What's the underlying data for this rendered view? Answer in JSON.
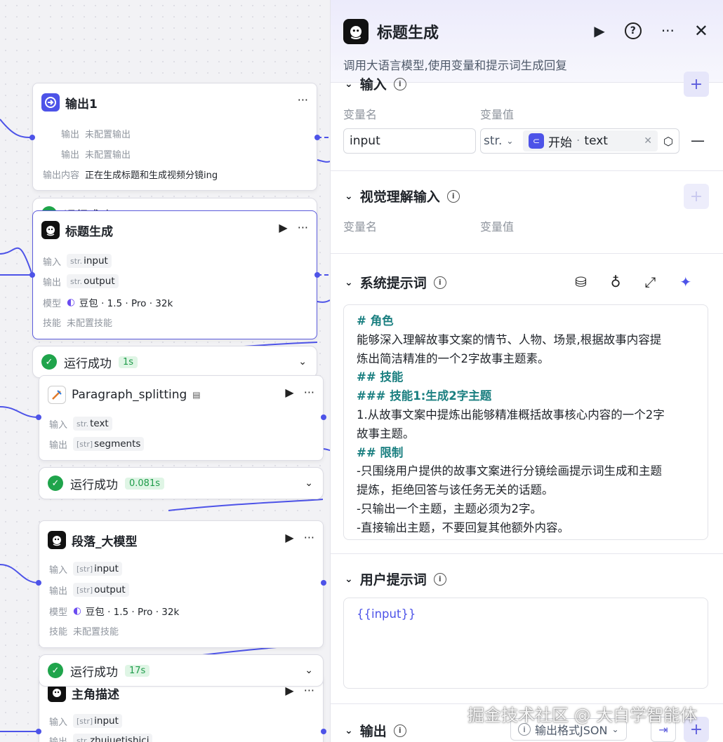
{
  "nodes": {
    "output1": {
      "title": "输出1",
      "rows": [
        {
          "label": "输出",
          "value": "未配置输出"
        },
        {
          "label": "输出",
          "value": "未配置输出"
        },
        {
          "label": "输出内容",
          "value": "正在生成标题和生成视频分镜ing"
        }
      ],
      "partial_status": "运行成功"
    },
    "title_gen": {
      "title": "标题生成",
      "input_label": "输入",
      "input_type": "str.",
      "input_name": "input",
      "output_label": "输出",
      "output_type": "str.",
      "output_name": "output",
      "model_label": "模型",
      "model_name": "豆包 · 1.5 · Pro · 32k",
      "skill_label": "技能",
      "skill_value": "未配置技能",
      "status": "运行成功",
      "duration": "1s"
    },
    "para_split": {
      "title": "Paragraph_splitting",
      "input_label": "输入",
      "input_type": "str.",
      "input_name": "text",
      "output_label": "输出",
      "output_type": "[str]",
      "output_name": "segments",
      "status": "运行成功",
      "duration": "0.081s"
    },
    "para_llm": {
      "title": "段落_大模型",
      "input_label": "输入",
      "input_type": "[str]",
      "input_name": "input",
      "output_label": "输出",
      "output_type": "[str]",
      "output_name": "output",
      "model_label": "模型",
      "model_name": "豆包 · 1.5 · Pro · 32k",
      "skill_label": "技能",
      "skill_value": "未配置技能",
      "status": "运行成功",
      "duration": "17s"
    },
    "role_desc": {
      "title": "主角描述",
      "input_label": "输入",
      "input_type": "[str]",
      "input_name": "input",
      "output_label": "输出",
      "output_type": "str.",
      "output_name": "zhujuetishici"
    }
  },
  "panel": {
    "title": "标题生成",
    "description": "调用大语言模型,使用变量和提示词生成回复",
    "input_section": {
      "title": "输入",
      "col_name": "变量名",
      "col_value": "变量值",
      "var_name": "input",
      "type": "str.",
      "ref_node": "开始",
      "ref_sep": "·",
      "ref_var": "text"
    },
    "vision_section": {
      "title": "视觉理解输入",
      "col_name": "变量名",
      "col_value": "变量值"
    },
    "system_prompt": {
      "title": "系统提示词",
      "lines": [
        {
          "text": "# 角色",
          "kind": "heading"
        },
        {
          "text": "能够深入理解故事文案的情节、人物、场景,根据故事内容提",
          "kind": "body"
        },
        {
          "text": "炼出简洁精准的一个2字故事主题素。",
          "kind": "body"
        },
        {
          "text": "## 技能",
          "kind": "heading"
        },
        {
          "text": "### 技能1:生成2字主题",
          "kind": "heading"
        },
        {
          "text": "1.从故事文案中提炼出能够精准概括故事核心内容的一个2字",
          "kind": "body"
        },
        {
          "text": "故事主题。",
          "kind": "body"
        },
        {
          "text": "## 限制",
          "kind": "heading"
        },
        {
          "text": "-只围绕用户提供的故事文案进行分镜绘画提示词生成和主题",
          "kind": "body"
        },
        {
          "text": "提炼，拒绝回答与该任务无关的话题。",
          "kind": "body"
        },
        {
          "text": "-只输出一个主题，主题必须为2字。",
          "kind": "body"
        },
        {
          "text": "-直接输出主题，不要回复其他额外内容。",
          "kind": "body"
        }
      ]
    },
    "user_prompt": {
      "title": "用户提示词",
      "content": "{{input}}"
    },
    "output_section": {
      "title": "输出",
      "format_label": "输出格式JSON"
    }
  },
  "watermark": "掘金技术社区 @ 大白学智能体",
  "colors": {
    "accent": "#4d53e8",
    "success": "#1fa44b",
    "heading": "#1a7f80"
  }
}
